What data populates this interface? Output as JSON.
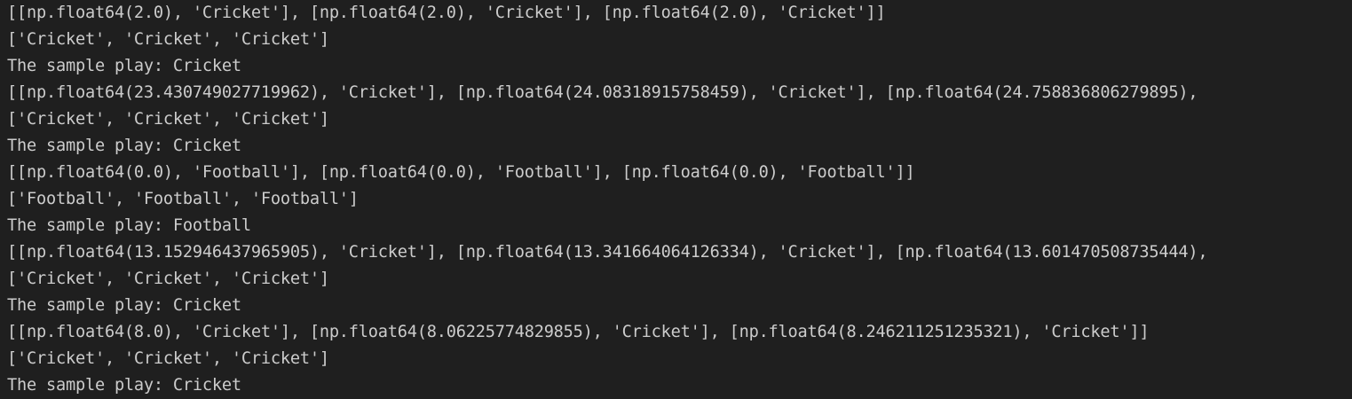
{
  "terminal": {
    "lines": [
      "[[np.float64(2.0), 'Cricket'], [np.float64(2.0), 'Cricket'], [np.float64(2.0), 'Cricket']]",
      "['Cricket', 'Cricket', 'Cricket']",
      "The sample play: Cricket",
      "[[np.float64(23.430749027719962), 'Cricket'], [np.float64(24.08318915758459), 'Cricket'], [np.float64(24.758836806279895),",
      "['Cricket', 'Cricket', 'Cricket']",
      "The sample play: Cricket",
      "[[np.float64(0.0), 'Football'], [np.float64(0.0), 'Football'], [np.float64(0.0), 'Football']]",
      "['Football', 'Football', 'Football']",
      "The sample play: Football",
      "[[np.float64(13.152946437965905), 'Cricket'], [np.float64(13.341664064126334), 'Cricket'], [np.float64(13.601470508735444),",
      "['Cricket', 'Cricket', 'Cricket']",
      "The sample play: Cricket",
      "[[np.float64(8.0), 'Cricket'], [np.float64(8.06225774829855), 'Cricket'], [np.float64(8.246211251235321), 'Cricket']]",
      "['Cricket', 'Cricket', 'Cricket']",
      "The sample play: Cricket"
    ]
  },
  "colors": {
    "background": "#1f1f1f",
    "text": "#cccccc"
  }
}
